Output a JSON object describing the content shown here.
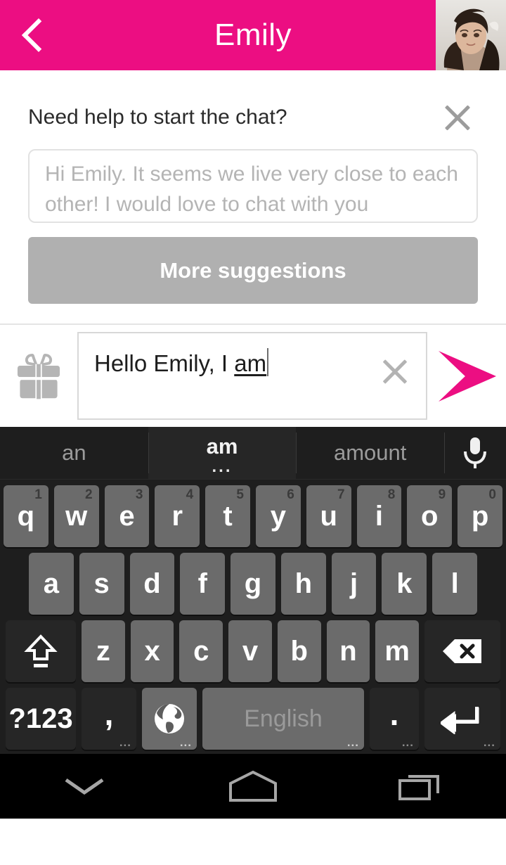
{
  "header": {
    "title": "Emily",
    "back_icon": "chevron-left-icon",
    "avatar_alt": "profile-photo"
  },
  "suggestion_panel": {
    "title": "Need help to start the chat?",
    "close_icon": "close-icon",
    "suggestion_text": "Hi Emily. It seems we live very close to each other! I would love to chat with you sometime.",
    "more_label": "More suggestions"
  },
  "input_row": {
    "gift_icon": "gift-icon",
    "typed_text": "Hello Emily, I ",
    "composing_text": "am",
    "clear_icon": "close-icon",
    "send_icon": "send-icon"
  },
  "keyboard": {
    "suggestions": [
      {
        "word": "an",
        "active": false
      },
      {
        "word": "am",
        "active": true,
        "dots": "..."
      },
      {
        "word": "amount",
        "active": false
      }
    ],
    "mic_icon": "microphone-icon",
    "row1": [
      {
        "key": "q",
        "num": "1"
      },
      {
        "key": "w",
        "num": "2"
      },
      {
        "key": "e",
        "num": "3"
      },
      {
        "key": "r",
        "num": "4"
      },
      {
        "key": "t",
        "num": "5"
      },
      {
        "key": "y",
        "num": "6"
      },
      {
        "key": "u",
        "num": "7"
      },
      {
        "key": "i",
        "num": "8"
      },
      {
        "key": "o",
        "num": "9"
      },
      {
        "key": "p",
        "num": "0"
      }
    ],
    "row2": [
      {
        "key": "a"
      },
      {
        "key": "s"
      },
      {
        "key": "d"
      },
      {
        "key": "f"
      },
      {
        "key": "g"
      },
      {
        "key": "h"
      },
      {
        "key": "j"
      },
      {
        "key": "k"
      },
      {
        "key": "l"
      }
    ],
    "row3": {
      "shift_icon": "shift-icon",
      "letters": [
        {
          "key": "z"
        },
        {
          "key": "x"
        },
        {
          "key": "c"
        },
        {
          "key": "v"
        },
        {
          "key": "b"
        },
        {
          "key": "n"
        },
        {
          "key": "m"
        }
      ],
      "backspace_icon": "backspace-icon"
    },
    "row4": {
      "symbols_label": "?123",
      "comma_label": ",",
      "globe_icon": "globe-icon",
      "space_label": "English",
      "period_label": ".",
      "enter_icon": "enter-icon",
      "hint_dots": "..."
    }
  },
  "navbar": {
    "back_icon": "keyboard-hide-chevron-icon",
    "home_icon": "home-icon",
    "recents_icon": "recents-icon"
  },
  "colors": {
    "brand_pink": "#ec0e82",
    "keyboard_bg": "#1e1e1e",
    "key_bg": "#6b6b6b",
    "key_dark_bg": "#262626",
    "more_btn_bg": "#b0b0b0"
  }
}
